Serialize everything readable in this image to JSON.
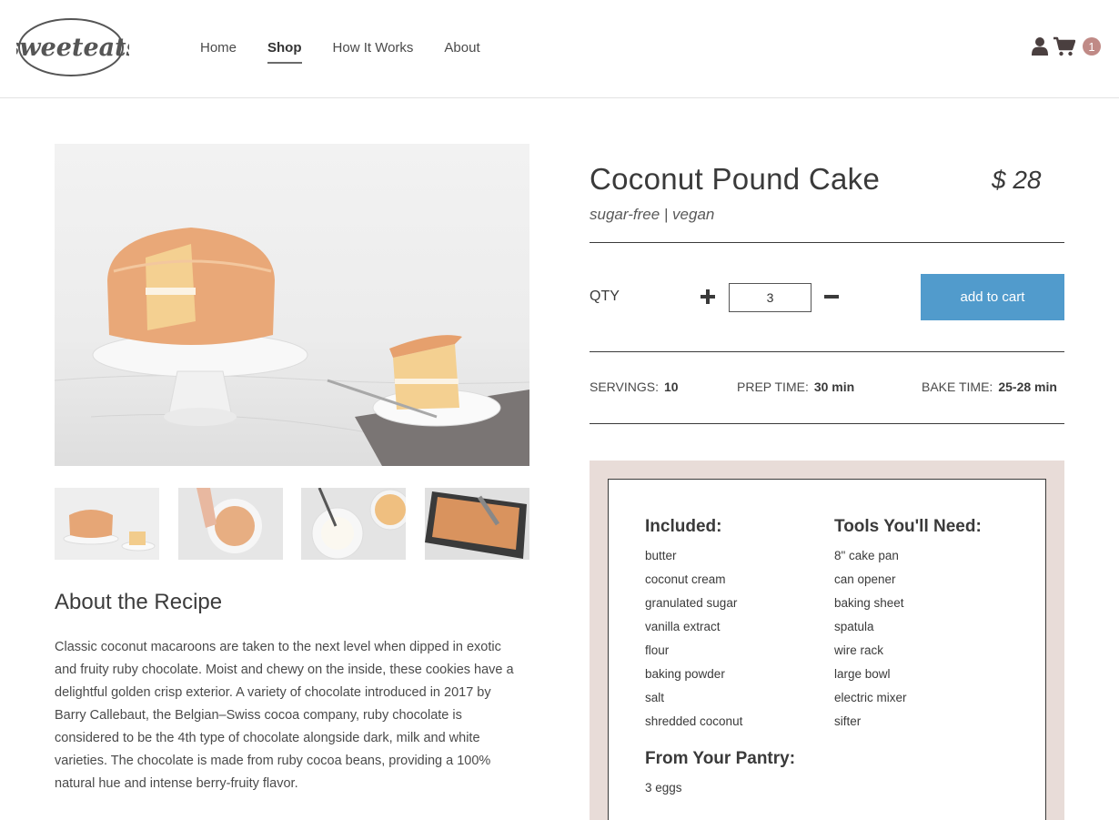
{
  "brand": {
    "logo_text": "sweeteats"
  },
  "nav": {
    "items": [
      {
        "label": "Home",
        "active": false
      },
      {
        "label": "Shop",
        "active": true
      },
      {
        "label": "How It Works",
        "active": false
      },
      {
        "label": "About",
        "active": false
      }
    ]
  },
  "header": {
    "cart_count": "1",
    "icons": [
      "user-icon",
      "cart-icon"
    ]
  },
  "product": {
    "title": "Coconut Pound Cake",
    "price": "$ 28",
    "tags": "sugar-free | vegan",
    "qty_label": "QTY",
    "qty_value": "3",
    "add_to_cart": "add to cart",
    "stats": [
      {
        "label": "SERVINGS:",
        "value": "10"
      },
      {
        "label": "PREP TIME:",
        "value": "30 min"
      },
      {
        "label": "BAKE TIME:",
        "value": "25-28 min"
      }
    ]
  },
  "about": {
    "title": "About the Recipe",
    "text": "Classic coconut macaroons are taken to the next level when dipped in exotic and fruity ruby chocolate. Moist and chewy on the inside, these cookies have a delightful golden crisp exterior. A variety of chocolate introduced in 2017 by Barry Callebaut, the Belgian–Swiss cocoa company, ruby chocolate is considered to be the 4th type of chocolate alongside dark, milk and white varieties. The chocolate is made from ruby cocoa beans, providing a 100% natural hue and intense berry-fruity flavor."
  },
  "recipe": {
    "included_title": "Included:",
    "included": [
      "butter",
      "coconut cream",
      "granulated sugar",
      "vanilla extract",
      "flour",
      "baking powder",
      "salt",
      "shredded coconut"
    ],
    "tools_title": "Tools You'll Need:",
    "tools": [
      "8\" cake pan",
      "can opener",
      "baking sheet",
      "spatula",
      "wire rack",
      "large bowl",
      "electric mixer",
      "sifter"
    ],
    "pantry_title": "From Your Pantry:",
    "pantry": [
      "3 eggs"
    ]
  },
  "colors": {
    "accent": "#519bcc",
    "badge": "#c08a86",
    "recipe_bg": "#e8dcd8",
    "text": "#3a3a3a"
  }
}
